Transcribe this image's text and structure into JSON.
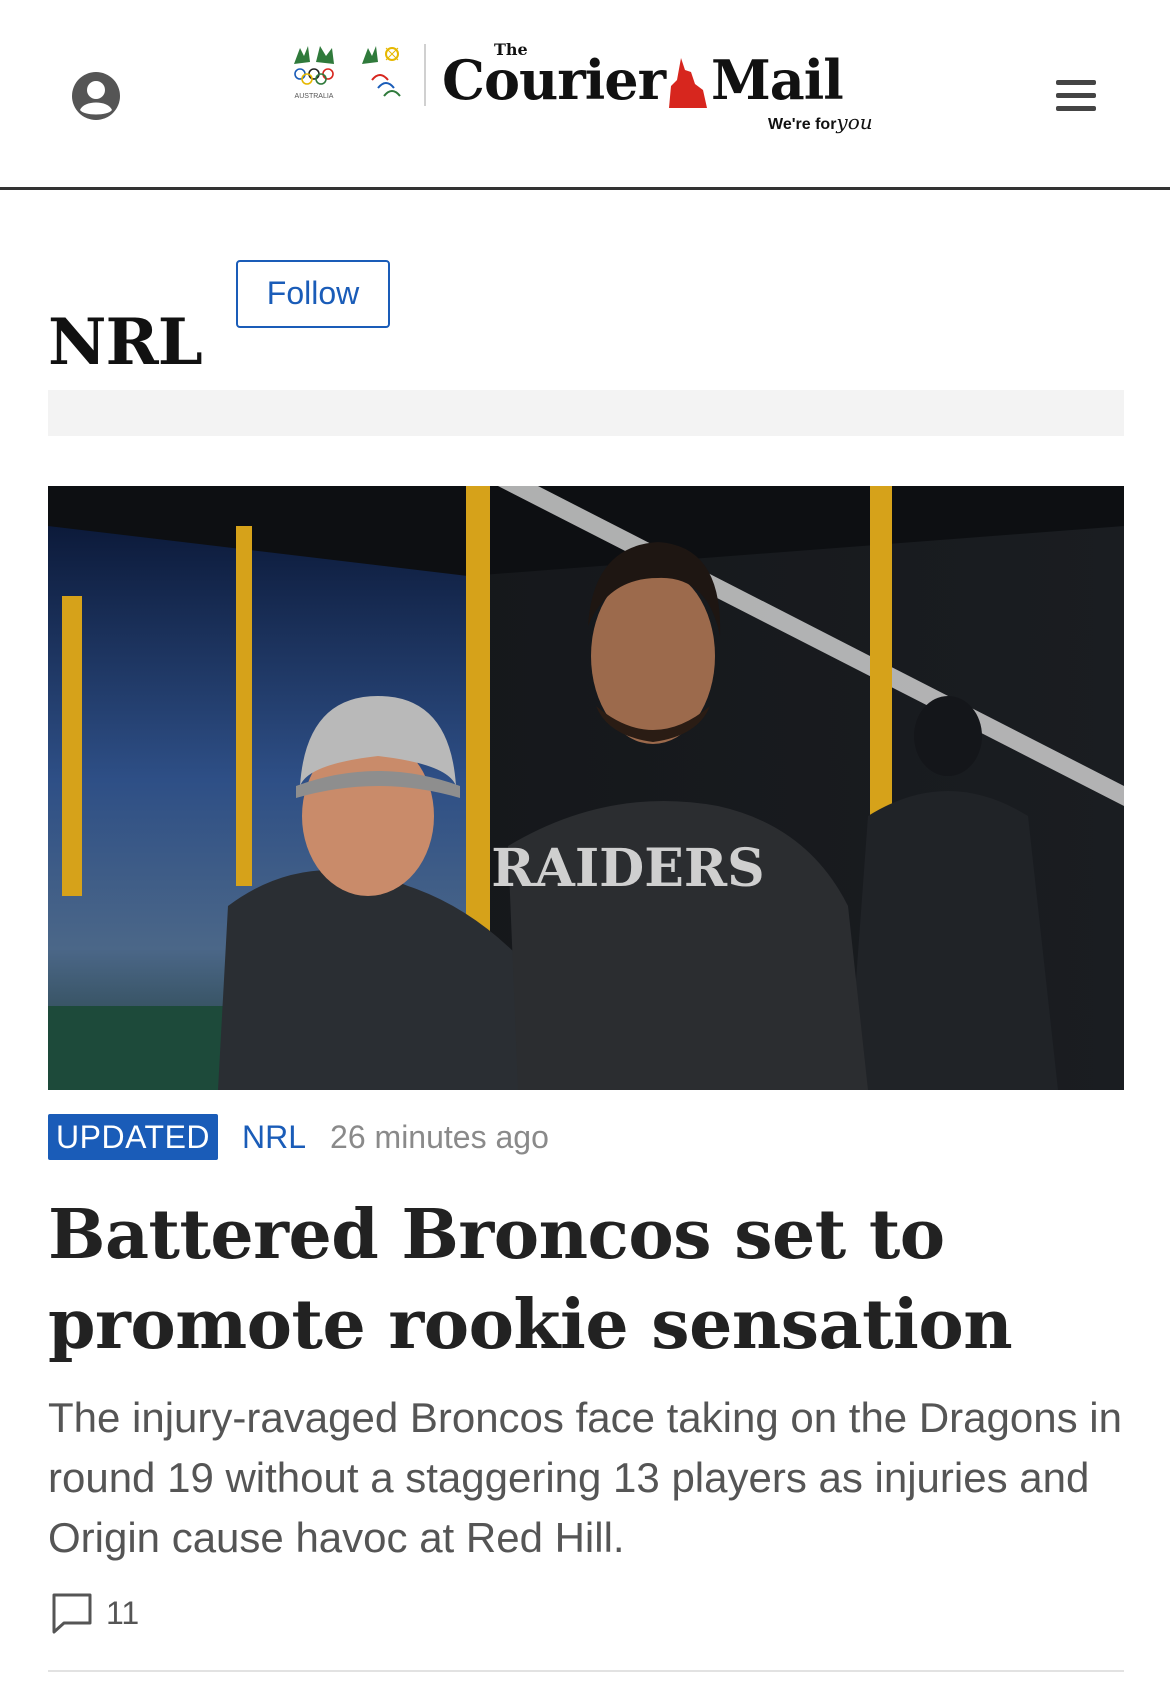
{
  "header": {
    "masthead_the": "The",
    "masthead_word1": "Courier",
    "masthead_word2": "Mail",
    "tagline_prefix": "We're for",
    "tagline_you": "you",
    "olympic_label": "AUSTRALIA",
    "paralympic_label": "Paralympics Australia"
  },
  "section": {
    "title": "NRL",
    "follow_label": "Follow"
  },
  "story": {
    "badge": "UPDATED",
    "category": "NRL",
    "time": "26 minutes ago",
    "headline": "Battered Broncos set to promote rookie sensation",
    "standfirst": "The injury-ravaged Broncos face taking on the Dragons in round 19 without a staggering 13 players as injuries and Origin cause havoc at Red Hill.",
    "comment_count": "11",
    "image_shirt_text": "RAIDERS"
  },
  "colors": {
    "accent_blue": "#1a5cb8",
    "masthead_red": "#d7261e",
    "meta_grey": "#8a8a8a"
  },
  "icons": {
    "account": "account-icon",
    "menu": "hamburger-menu-icon",
    "comment": "comment-icon",
    "qld": "queensland-map-icon"
  }
}
